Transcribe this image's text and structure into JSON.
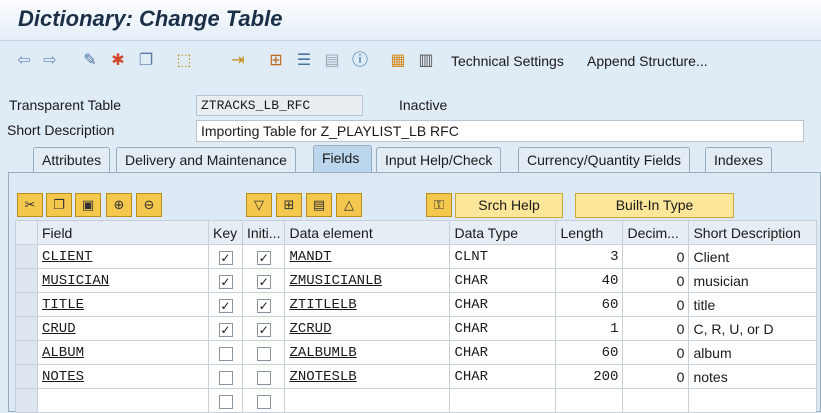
{
  "window": {
    "title": "Dictionary: Change Table"
  },
  "toolbar": {
    "icons": [
      "back-arrow-icon",
      "forward-arrow-icon",
      "glasses-pencil-icon",
      "activate-icon",
      "copy-object-icon",
      "other-object-icon",
      "where-used-icon",
      "hierarchy-icon",
      "align-icon",
      "layout-icon",
      "info-icon",
      "fields-grid-icon",
      "table-grid-icon"
    ],
    "technical_settings": "Technical Settings",
    "append_structure": "Append Structure..."
  },
  "header": {
    "table_type_label": "Transparent Table",
    "table_name": "ZTRACKS_LB_RFC",
    "status": "Inactive",
    "short_desc_label": "Short Description",
    "short_desc_value": "Importing Table for Z_PLAYLIST_LB RFC"
  },
  "tabs": [
    {
      "label": "Attributes",
      "active": false
    },
    {
      "label": "Delivery and Maintenance",
      "active": false
    },
    {
      "label": "Fields",
      "active": true
    },
    {
      "label": "Input Help/Check",
      "active": false
    },
    {
      "label": "Currency/Quantity Fields",
      "active": false
    },
    {
      "label": "Indexes",
      "active": false
    }
  ],
  "fields_toolbar": {
    "srch_help": "Srch Help",
    "builtin_type": "Built-In Type"
  },
  "grid": {
    "columns": [
      "Field",
      "Key",
      "Initi...",
      "Data element",
      "Data Type",
      "Length",
      "Decim...",
      "Short Description"
    ],
    "rows": [
      {
        "field": "CLIENT",
        "key": true,
        "init": true,
        "element": "MANDT",
        "type": "CLNT",
        "length": "3",
        "dec": "0",
        "desc": "Client"
      },
      {
        "field": "MUSICIAN",
        "key": true,
        "init": true,
        "element": "ZMUSICIANLB",
        "type": "CHAR",
        "length": "40",
        "dec": "0",
        "desc": "musician"
      },
      {
        "field": "TITLE",
        "key": true,
        "init": true,
        "element": "ZTITLELB",
        "type": "CHAR",
        "length": "60",
        "dec": "0",
        "desc": "title"
      },
      {
        "field": "CRUD",
        "key": true,
        "init": true,
        "element": "ZCRUD",
        "type": "CHAR",
        "length": "1",
        "dec": "0",
        "desc": "C, R, U, or D"
      },
      {
        "field": "ALBUM",
        "key": false,
        "init": false,
        "element": "ZALBUMLB",
        "type": "CHAR",
        "length": "60",
        "dec": "0",
        "desc": "album"
      },
      {
        "field": "NOTES",
        "key": false,
        "init": false,
        "element": "ZNOTESLB",
        "type": "CHAR",
        "length": "200",
        "dec": "0",
        "desc": "notes"
      }
    ]
  }
}
